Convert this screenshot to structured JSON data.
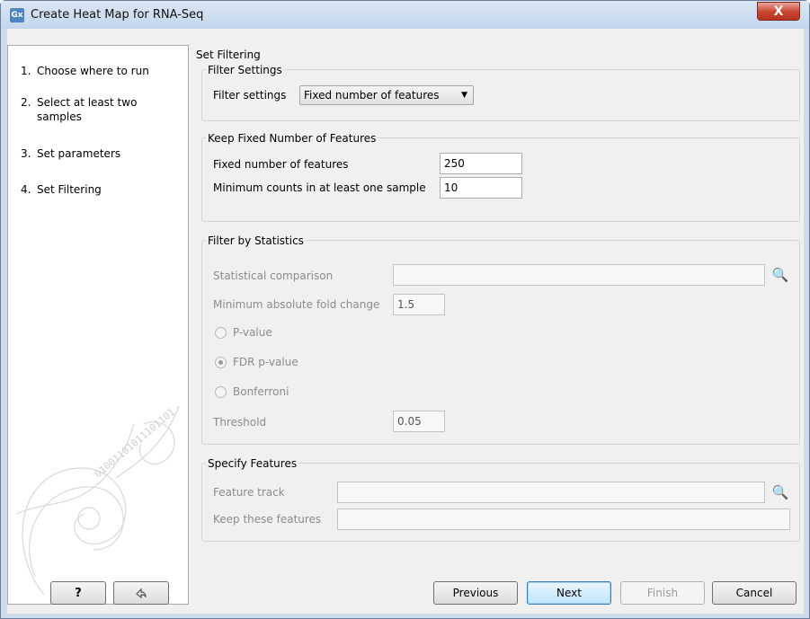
{
  "window": {
    "title": "Create Heat Map for RNA-Seq",
    "app_icon_text": "Gx",
    "close_label": "X"
  },
  "steps": [
    {
      "num": "1.",
      "label": "Choose where to run"
    },
    {
      "num": "2.",
      "label": "Select at least two samples"
    },
    {
      "num": "3.",
      "label": "Set parameters"
    },
    {
      "num": "4.",
      "label": "Set Filtering"
    }
  ],
  "panel": {
    "title": "Set Filtering",
    "filter_settings": {
      "group_title": "Filter Settings",
      "label": "Filter settings",
      "selected": "Fixed number of features"
    },
    "fixed_features": {
      "group_title": "Keep Fixed Number of Features",
      "fixed_label": "Fixed number of features",
      "fixed_value": "250",
      "min_label": "Minimum counts in at least one sample",
      "min_value": "10"
    },
    "statistics": {
      "group_title": "Filter by Statistics",
      "comparison_label": "Statistical comparison",
      "comparison_value": "",
      "fold_label": "Minimum absolute fold change",
      "fold_value": "1.5",
      "pvalue_label": "P-value",
      "fdr_label": "FDR p-value",
      "bonferroni_label": "Bonferroni",
      "threshold_label": "Threshold",
      "threshold_value": "0.05"
    },
    "specify": {
      "group_title": "Specify Features",
      "track_label": "Feature track",
      "track_value": "",
      "keep_label": "Keep these features",
      "keep_value": ""
    }
  },
  "buttons": {
    "help": "?",
    "previous": "Previous",
    "next": "Next",
    "finish": "Finish",
    "cancel": "Cancel"
  },
  "watermark_text": "01001101011101101"
}
